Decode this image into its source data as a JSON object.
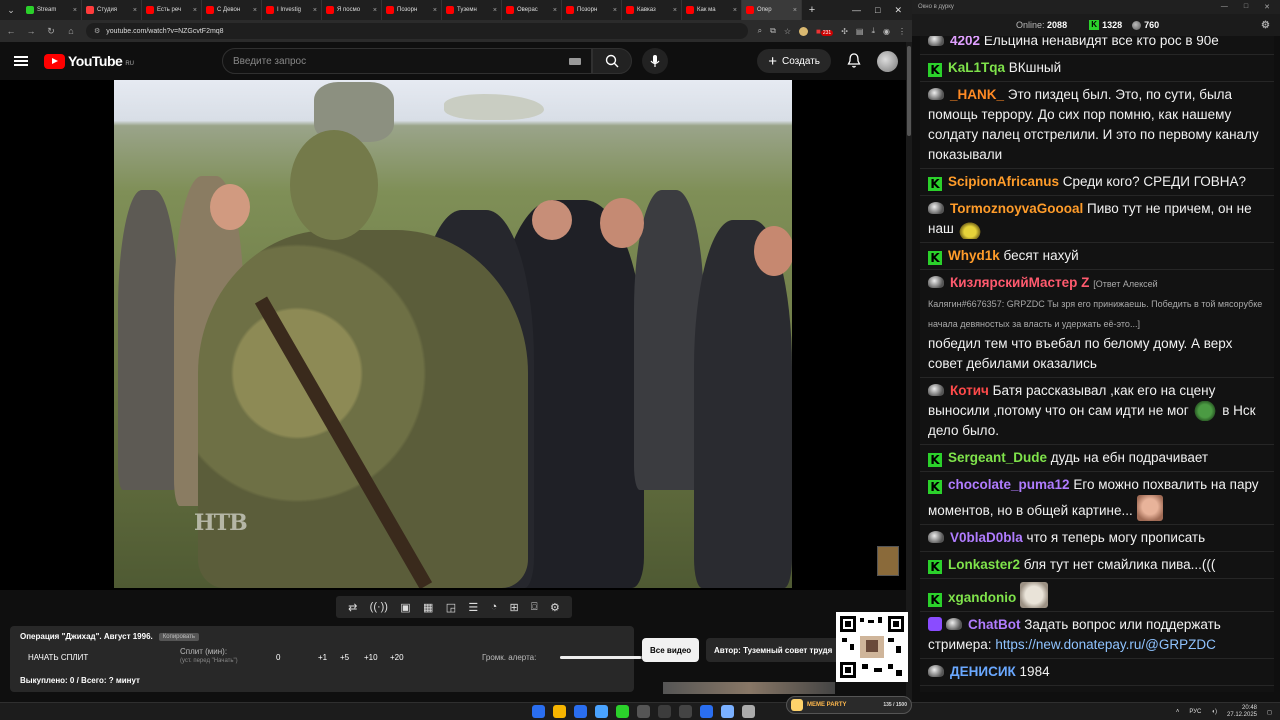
{
  "browser": {
    "tabs": [
      {
        "label": "Stream",
        "color": "#2bd12b"
      },
      {
        "label": "Студия",
        "color": "#ff3b3b"
      },
      {
        "label": "Есть реч",
        "color": "#ff0000"
      },
      {
        "label": "С Девон",
        "color": "#ff0000"
      },
      {
        "label": "I Investig",
        "color": "#ff0000"
      },
      {
        "label": "Я посмо",
        "color": "#ff0000"
      },
      {
        "label": "Позорн",
        "color": "#ff0000"
      },
      {
        "label": "Туземн",
        "color": "#ff0000"
      },
      {
        "label": "Оверас",
        "color": "#ff0000"
      },
      {
        "label": "Позорн",
        "color": "#ff0000"
      },
      {
        "label": "Кавказ",
        "color": "#ff0000"
      },
      {
        "label": "Как ма",
        "color": "#ff0000"
      },
      {
        "label": "Опер",
        "color": "#ff0000"
      }
    ],
    "url": "youtube.com/watch?v=NZGcvtF2mq8",
    "ext_badge": "231"
  },
  "youtube": {
    "logo_text": "YouTube",
    "region": "RU",
    "search_placeholder": "Введите запрос",
    "create_label": "Создать"
  },
  "video": {
    "watermark": "НТВ"
  },
  "extension": {
    "title": "Операция \"Джихад\". Август 1996.",
    "copy_label": "Копировать",
    "start_split": "НАЧАТЬ СПЛИТ",
    "split_label": "Сплит (мин):",
    "split_hint": "(уст. перед \"Начать\")",
    "split_value": "0",
    "plus_buttons": [
      "+1",
      "+5",
      "+10",
      "+20"
    ],
    "volume_label": "Громк. алерта:",
    "volume_level": 0.97,
    "bought": "Выкуплено: 0 / Всего: ? минут"
  },
  "buttons": {
    "all_videos": "Все видео",
    "author": "Автор: Туземный совет трудя"
  },
  "chat_window": {
    "title": "Окно в дурку",
    "online_label": "Online:",
    "online_value": "2088",
    "kick_count": "1328",
    "twitch_count": "760"
  },
  "chat": {
    "messages": [
      {
        "badge": "twitch",
        "nick": "4202",
        "color": "#e0a0ff",
        "text": "Ельцина ненавидят все кто рос в 90е"
      },
      {
        "badge": "kick",
        "nick": "KaL1Tqa",
        "color": "#7fe34b",
        "text": "ВКшный"
      },
      {
        "badge": "twitch",
        "nick": "_HANK_",
        "color": "#ff8a24",
        "text": "Это пиздец был. Это, по сути, была помощь террору. До сих пор помню, как нашему солдату палец отстрелили. И это по первому каналу показывали"
      },
      {
        "badge": "kick",
        "nick": "ScipionAfricanus",
        "color": "#ff9c2a",
        "text": "Среди кого? СРЕДИ ГОВНА?"
      },
      {
        "badge": "twitch",
        "nick": "TormoznoyvaGoooal",
        "color": "#ff9c2a",
        "text": "Пиво тут не причем, он не наш"
      },
      {
        "badge": "kick",
        "nick": "Whyd1k",
        "color": "#ff9c2a",
        "text": "бесят нахуй"
      },
      {
        "badge": "twitch",
        "nick": "КизлярскийМастер Z",
        "color": "#ff5a6e",
        "reply_head": "[Ответ Алексей",
        "reply_body": "Калягин#6676357: GRPZDC Ты зря его принижаешь. Победить в той мясорубке начала девяностых за власть и удержать её-это...]",
        "text": "победил тем что въебал по белому дому. А верх совет дебилами оказались"
      },
      {
        "badge": "twitch",
        "nick": "Котич",
        "color": "#ff4a4a",
        "text": "Батя рассказывал ,как его на сцену выносили ,потому что он сам идти не мог",
        "text_after": "в Нск дело было."
      },
      {
        "badge": "kick",
        "nick": "Sergeant_Dude",
        "color": "#7fe34b",
        "text": "дудь на ебн подрачивает"
      },
      {
        "badge": "kick",
        "nick": "chocolate_puma12",
        "color": "#b07cff",
        "text": "Его можно похвалить на пару моментов, но в общей картине..."
      },
      {
        "badge": "twitch",
        "nick": "V0blaD0bla",
        "color": "#b07cff",
        "text": "что я теперь могу пропиcать"
      },
      {
        "badge": "kick",
        "nick": "Lonkaster2",
        "color": "#7fe34b",
        "text": "бля тут нет смайлика пива...((("
      },
      {
        "badge": "kick",
        "nick": "xgandonio",
        "color": "#7fe34b",
        "text": ""
      },
      {
        "badge": "bot",
        "nick": "ChatBot",
        "color": "#b07cff",
        "text": "Задать вопрос или поддержать стримера:",
        "link": "https://new.donatepay.ru/@GRPZDC"
      },
      {
        "badge": "twitch",
        "nick": "ДЕНИСИК",
        "color": "#6aa8ff",
        "text": "1984"
      }
    ]
  },
  "taskbar": {
    "meme_party": "MEME PARTY",
    "meme_count": "135 / 1500",
    "lang": "РУС",
    "time": "20:48",
    "date": "27.12.2025",
    "icons": [
      "#2a6ef0",
      "#f7b500",
      "#2a6ef0",
      "#4aa3ff",
      "#2bd12b",
      "#555",
      "#3c3c3c",
      "#444",
      "#2a6ef0",
      "#7ab0ff",
      "#aaa"
    ]
  }
}
